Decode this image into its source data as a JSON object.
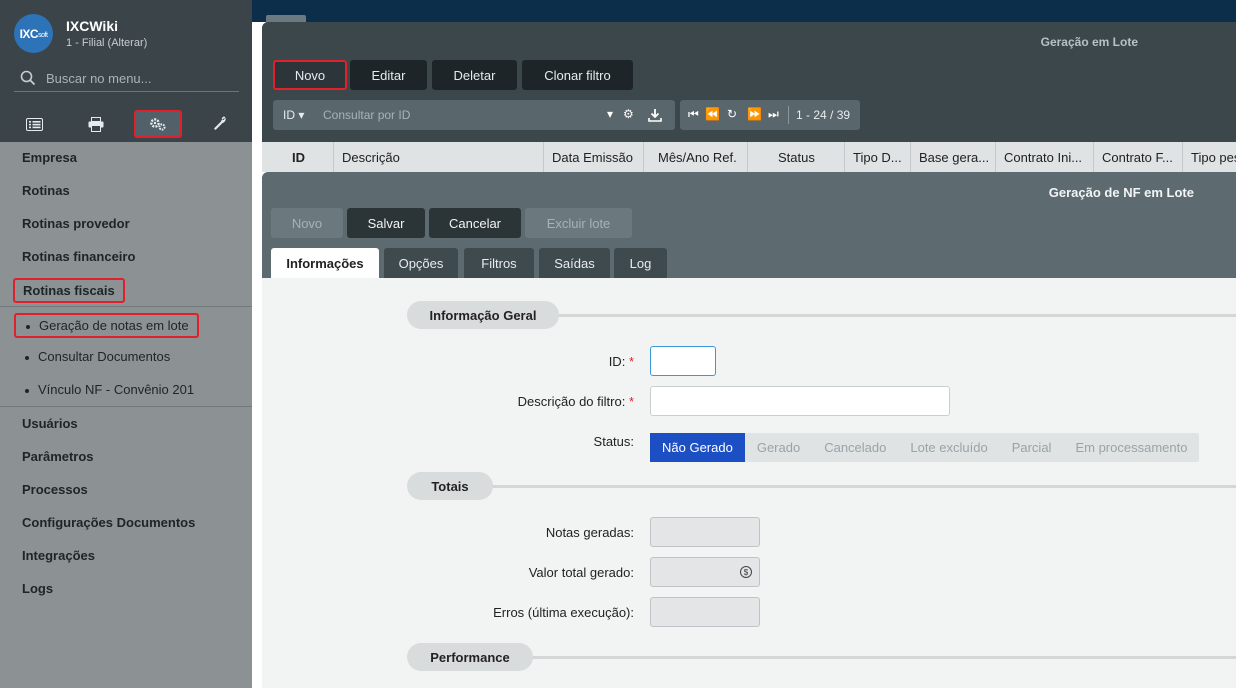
{
  "sidebar": {
    "logo_text": "IXC",
    "logo_soft": "soft",
    "app_title": "IXCWiki",
    "app_subtitle": "1 - Filial (Alterar)",
    "search_placeholder": "Buscar no menu...",
    "iconbar": [
      "list-icon",
      "printer-icon",
      "gears-icon",
      "wrench-icon"
    ],
    "active_icon": "gears-icon",
    "menu": {
      "empresa": "Empresa",
      "rotinas": "Rotinas",
      "rotinas_provedor": "Rotinas provedor",
      "rotinas_financeiro": "Rotinas financeiro",
      "rotinas_fiscais": "Rotinas fiscais",
      "sub_items": [
        "Geração de notas em lote",
        "Consultar Documentos",
        "Vínculo NF - Convênio 201"
      ],
      "usuarios": "Usuários",
      "parametros": "Parâmetros",
      "processos": "Processos",
      "config_documentos": "Configurações Documentos",
      "integracoes": "Integrações",
      "logs": "Logs"
    }
  },
  "list_window": {
    "title": "Geração em Lote",
    "toolbar": {
      "novo": "Novo",
      "editar": "Editar",
      "deletar": "Deletar",
      "clonar": "Clonar filtro"
    },
    "filter": {
      "field": "ID",
      "placeholder": "Consultar por ID"
    },
    "pager": {
      "range": "1 - 24 / 39"
    },
    "columns": [
      "ID",
      "Descrição",
      "Data Emissão",
      "Mês/Ano Ref.",
      "Status",
      "Tipo D...",
      "Base gera...",
      "Contrato Ini...",
      "Contrato F...",
      "Tipo pes"
    ]
  },
  "modal": {
    "title": "Geração de NF em Lote",
    "buttons": {
      "novo": "Novo",
      "salvar": "Salvar",
      "cancelar": "Cancelar",
      "excluir": "Excluir lote"
    },
    "tabs": [
      "Informações",
      "Opções",
      "Filtros",
      "Saídas",
      "Log"
    ],
    "active_tab": "Informações",
    "sections": {
      "info_geral": "Informação Geral",
      "totais": "Totais",
      "performance": "Performance"
    },
    "fields": {
      "id_label": "ID:",
      "id_value": "",
      "descricao_label": "Descrição do filtro:",
      "descricao_value": "",
      "status_label": "Status:",
      "status_options": [
        "Não Gerado",
        "Gerado",
        "Cancelado",
        "Lote excluído",
        "Parcial",
        "Em processamento"
      ],
      "status_selected": "Não Gerado",
      "notas_label": "Notas geradas:",
      "valor_label": "Valor total gerado:",
      "erros_label": "Erros (última execução):",
      "required_mark": "*"
    }
  },
  "colors": {
    "highlight": "#e0202a",
    "accent_blue": "#1d4fc4",
    "sidebar_dark": "#3b4549",
    "sidebar_menu": "#8c9193"
  }
}
